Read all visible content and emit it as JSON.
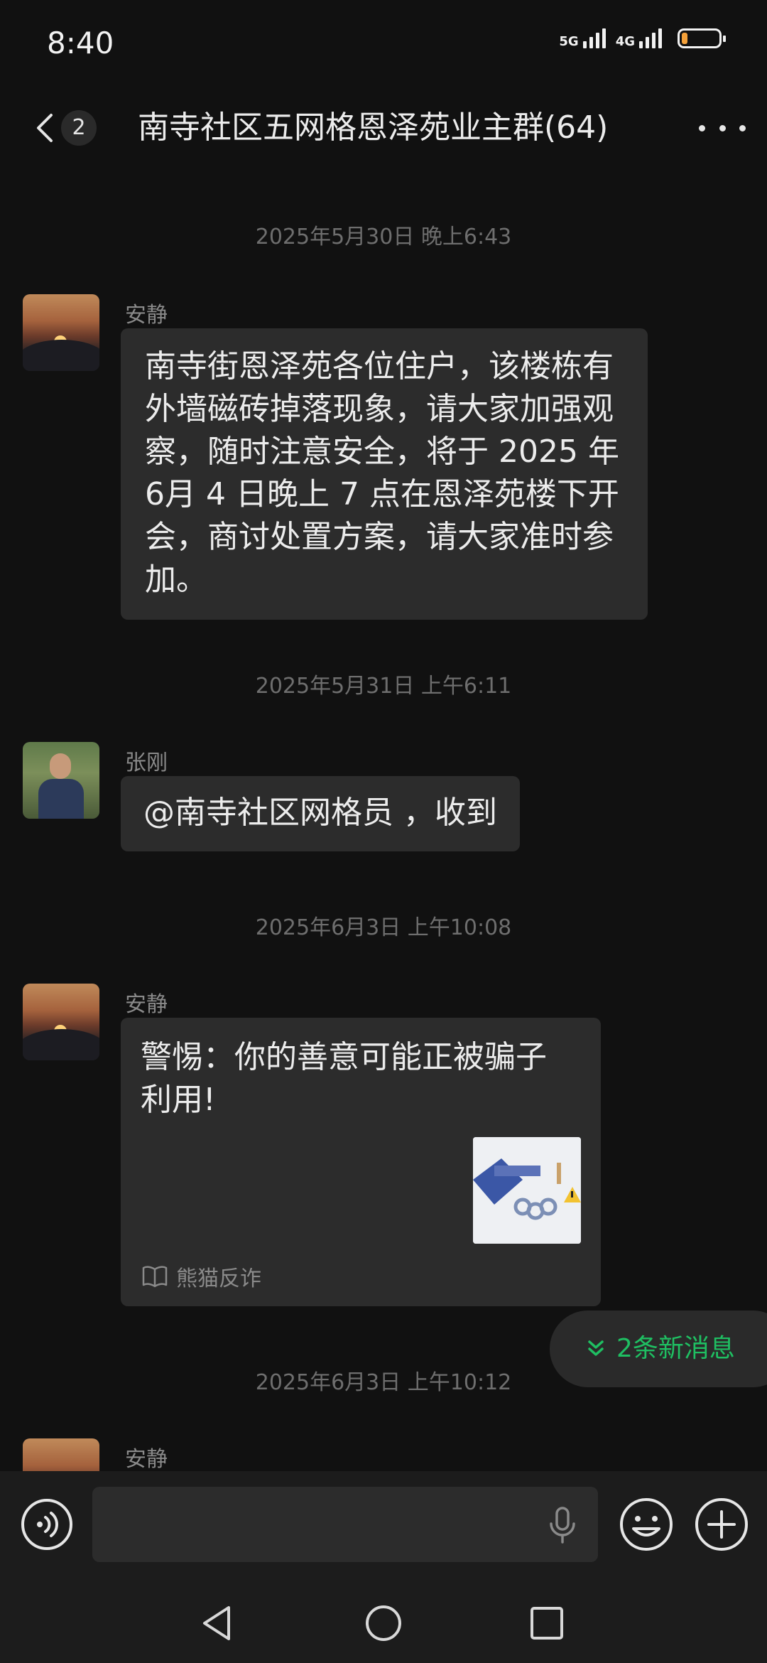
{
  "status_bar": {
    "time": "8:40",
    "network_1": "5G",
    "network_2": "4G",
    "battery_level": 0.15,
    "battery_color": "#f4a13a"
  },
  "header": {
    "unread_count": "2",
    "title": "南寺社区五网格恩泽苑业主群(64)",
    "back_icon": "chevron-left-icon",
    "more_icon": "more-dots-icon"
  },
  "messages": [
    {
      "timestamp": "2025年5月30日 晚上6:43",
      "sender": "安静",
      "text": "南寺街恩泽苑各位住户，该楼栋有外墙磁砖掉落现象，请大家加强观察，随时注意安全，将于 2025 年 6月 4 日晚上 7 点在恩泽苑楼下开会，商讨处置方案，请大家准时参加。"
    },
    {
      "timestamp": "2025年5月31日 上午6:11",
      "sender": "张刚",
      "text": "@南寺社区网格员 ，收到"
    },
    {
      "timestamp": "2025年6月3日 上午10:08",
      "sender": "安静",
      "card_title": "警惕：你的善意可能正被骗子利用!",
      "card_source": "熊猫反诈"
    },
    {
      "timestamp": "2025年6月3日 上午10:12",
      "sender": "安静"
    }
  ],
  "new_messages": {
    "label": "2条新消息",
    "color": "#1fbf62"
  },
  "input_bar": {
    "placeholder": "",
    "voice_icon": "voice-icon",
    "mic_icon": "mic-icon",
    "emoji_icon": "emoji-icon",
    "plus_icon": "plus-icon"
  },
  "nav_bar": {
    "back_icon": "nav-back-icon",
    "home_icon": "nav-home-icon",
    "recent_icon": "nav-recent-icon"
  }
}
